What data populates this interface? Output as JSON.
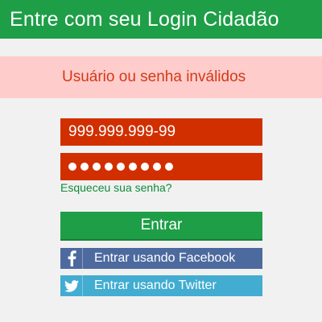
{
  "header": {
    "title": "Entre com seu Login Cidadão"
  },
  "error": {
    "message": "Usuário ou senha inválidos"
  },
  "form": {
    "cpf_value": "999.999.999-99",
    "password_length": 9,
    "forgot_label": "Esqueceu sua senha?",
    "enter_label": "Entrar"
  },
  "social": {
    "facebook_label": "Entrar usando Facebook",
    "twitter_label": "Entrar usando Twitter",
    "facebook_icon": "facebook-icon",
    "twitter_icon": "twitter-icon"
  },
  "colors": {
    "primary_green": "#1e9e47",
    "error_bg": "#ffcccc",
    "error_text": "#d23a16",
    "field_red": "#d12f00",
    "facebook_blue": "#4d6a9f",
    "twitter_blue": "#42acd1"
  }
}
